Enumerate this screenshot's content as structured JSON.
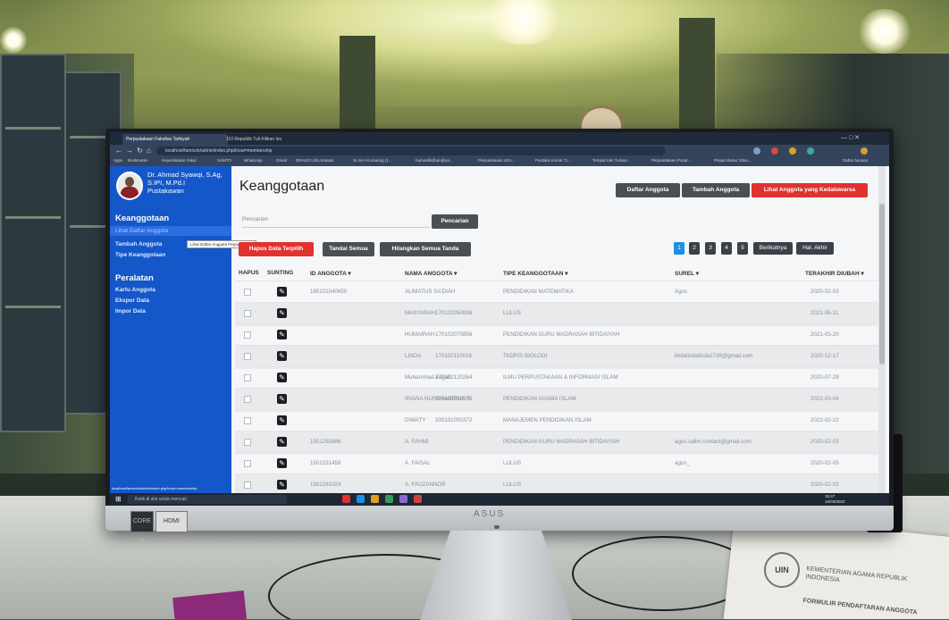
{
  "browser": {
    "tabs": [
      {
        "label": "Perpustakaan Fakultas Tarbiyah",
        "active": true
      },
      {
        "label": "110 Republik Tuli Kilikan Isu",
        "active": false
      }
    ],
    "url": "localhost/famicoh/admin/index.php/inout=membership",
    "bookmarks": [
      "Apps",
      "Bookmarks",
      "Kepustakaan Fakul",
      "SAMTO",
      "WhatsApp",
      "Gmail",
      "DRAKO UIN Antasari",
      "SI AKA Kumaring (1...",
      "humaslib@uin@ya...",
      "Perpustakaan UIN...",
      "Pustaka Komik 71...",
      "Tempat Ide! Tulisan...",
      "Perpustakaan Pusat...",
      "Pinjam Buku/ Sirku...",
      "Daftar bacaan"
    ]
  },
  "sidebar": {
    "user_name": "Dr. Ahmad Syawqi, S.Ag, S.IPI, M.Pd.I",
    "user_role": "Pustakawan",
    "section1": "Keanggotaan",
    "items1": [
      "Lihat Daftar Anggota",
      "Tambah Anggota",
      "Tipe Keanggotaan"
    ],
    "tooltip": "Lihat Daftar Anggota Perpustakaan",
    "section2": "Peralatan",
    "items2": [
      "Kartu Anggota",
      "Ekspor Data",
      "Impor Data"
    ]
  },
  "main": {
    "title": "Keanggotaan",
    "top_buttons": [
      "Daftar Anggota",
      "Tambah Anggota",
      "Lihat Anggota yang Kedaluwarsa"
    ],
    "search_label": "Pencarian",
    "search_button": "Pencarian",
    "action_buttons": [
      "Hapus Data Terpilih",
      "Tandai Semua",
      "Hilangkan Semua Tanda"
    ],
    "pagination": [
      "1",
      "2",
      "3",
      "4",
      "5",
      "Berikutnya",
      "Hal. Akhir"
    ],
    "columns": [
      "HAPUS",
      "SUNTING",
      "ID ANGGOTA ▾",
      "NAMA ANGGOTA ▾",
      "TIPE KEANGGOTAAN ▾",
      "SUREL ▾",
      "TERAKHIR DIUBAH ▾"
    ],
    "rows": [
      {
        "id": "180101040650",
        "name": "ALIMATUS SA'DIAH",
        "type": "PENDIDIKAN MATEMATIKA",
        "email": "Agus",
        "updated": "2020-02-03"
      },
      {
        "id": "",
        "name": "MASYARAH",
        "type": "170102050838",
        "email": "",
        "updated": "2021-06-11",
        "type2": "LULUS"
      },
      {
        "id": "",
        "name": "HUMAIRAH",
        "type": "170102070856",
        "email": "",
        "updated": "2021-05-20",
        "type2": "PENDIDIKAN GURU MADRASAH IBTIDAIYAH"
      },
      {
        "id": "",
        "name": "LINDA",
        "type": "170102110018",
        "email": "lindalindalinda1739@gmail.com",
        "updated": "2020-12-17",
        "type2": "TADRIS BIOLOGI"
      },
      {
        "id": "",
        "name": "Muhammad Asgari",
        "type": "170102120264",
        "email": "",
        "updated": "2020-07-29",
        "type2": "ILMU PERPUSTAKAAN & INFORMASI ISLAM"
      },
      {
        "id": "",
        "name": "IRIANA NURSHADRINA S",
        "type": "200101010076",
        "email": "",
        "updated": "2022-03-04",
        "type2": "PENDIDIKAN AGAMA ISLAM"
      },
      {
        "id": "",
        "name": "DIWATY",
        "type": "200101050372",
        "email": "",
        "updated": "2022-02-22",
        "type2": "MANAJEMEN PENDIDIKAN ISLAM"
      },
      {
        "id": "1501291686",
        "name": "A. FAHMI",
        "type": "PENDIDIKAN GURU MADRASAH IBTIDAIYAH",
        "email": "agus.salim.contact@gmail.com",
        "updated": "2020-02-03"
      },
      {
        "id": "1501231458",
        "name": "A. FAISAL",
        "type": "LULUS",
        "email": "agus_",
        "updated": "2020-02-05"
      },
      {
        "id": "1502261024",
        "name": "A. FAUZANNOR",
        "type": "LULUS",
        "email": "",
        "updated": "2020-02-03"
      }
    ]
  },
  "taskbar": {
    "search": "Ketik di sini untuk mencari",
    "clock_time": "15:47",
    "clock_date": "10/03/2022"
  },
  "scene": {
    "monitor_brand": "ASUS",
    "sticker1": "CORE i3",
    "sticker2": "HDMI",
    "paper_heading": "KEMENTERIAN AGAMA REPUBLIK INDONESIA",
    "paper_form": "FORMULIR PENDAFTARAN ANGGOTA",
    "paper_logo": "UIN"
  }
}
